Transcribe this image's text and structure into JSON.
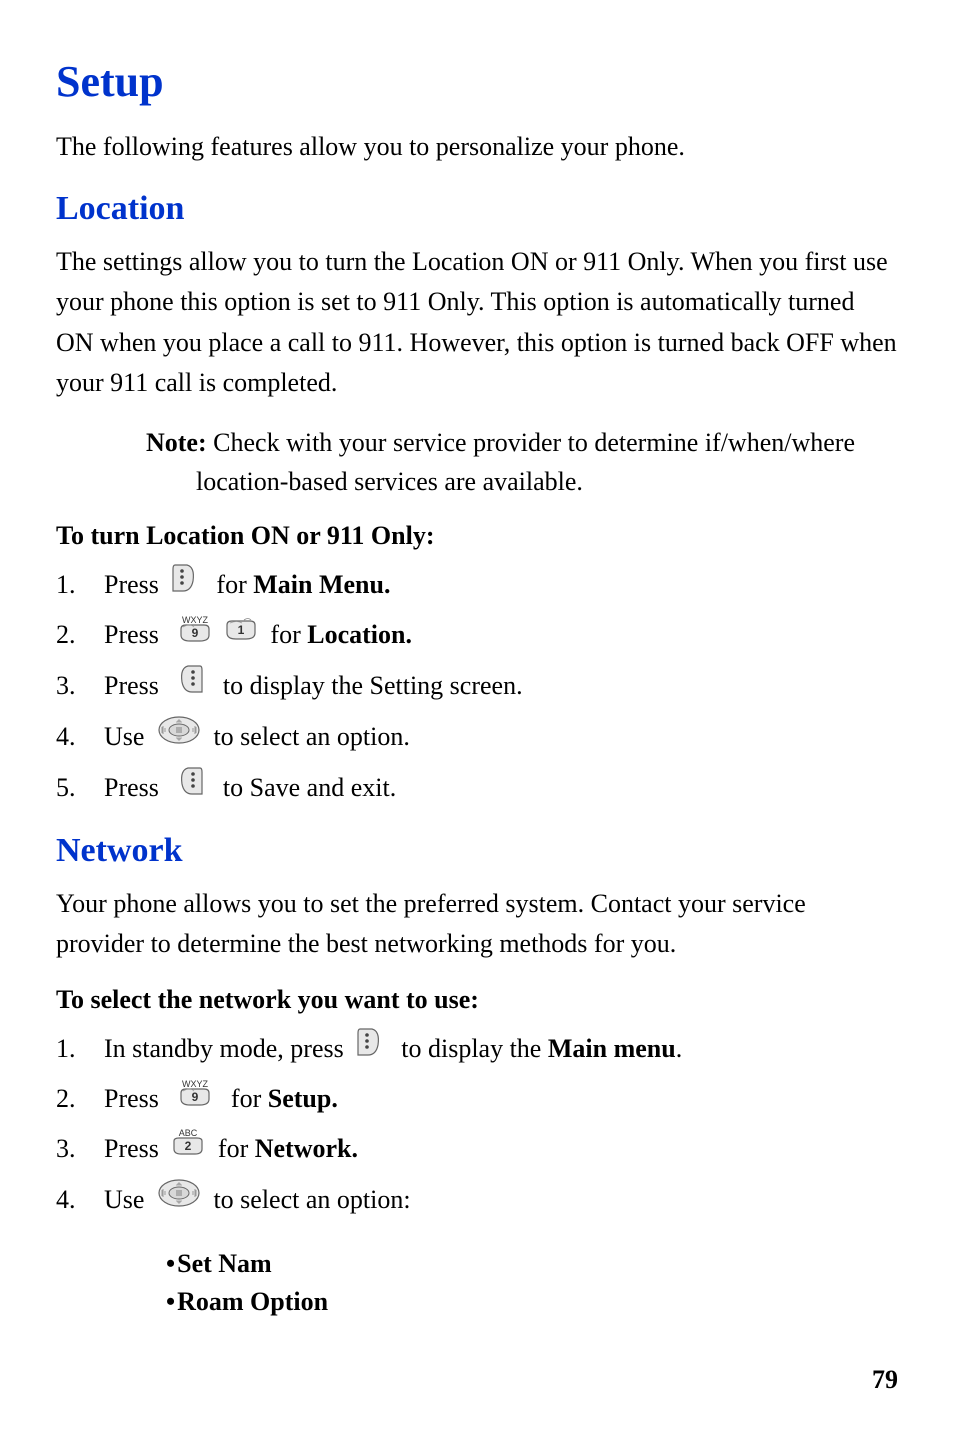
{
  "title": "Setup",
  "intro": "The following features allow you to personalize your phone.",
  "sections": {
    "location": {
      "heading": "Location",
      "body": "The settings allow you to turn the Location ON or 911 Only. When you first use your phone this option is set to 911 Only. This option is automatically turned ON when you place a call to 911. However, this option is turned back OFF when your 911 call is completed.",
      "note_label": "Note:",
      "note_text": " Check with your service provider to determine if/when/where location-based services are available.",
      "procedure_title": "To turn Location ON or 911 Only:",
      "steps": [
        {
          "num": "1.",
          "pre": "Press ",
          "icon": "left-dots-key",
          "post_b": "Main Menu.",
          "post": "  for "
        },
        {
          "num": "2.",
          "pre": "Press  ",
          "icons": [
            "key-9-wxyz",
            "key-1"
          ],
          "post": " for ",
          "post_b": "Location."
        },
        {
          "num": "3.",
          "pre": "Press  ",
          "icon": "right-dots-key",
          "post": "  to display the Setting screen."
        },
        {
          "num": "4.",
          "pre": "Use ",
          "icon": "nav-pad",
          "post": " to select an option."
        },
        {
          "num": "5.",
          "pre": "Press  ",
          "icon": "right-dots-key",
          "post": "  to Save and exit."
        }
      ]
    },
    "network": {
      "heading": "Network",
      "body": "Your phone allows you to set the preferred system. Contact your service provider to determine the best networking methods for you.",
      "procedure_title": "To select the network you want to use:",
      "steps": [
        {
          "num": "1.",
          "pre": "In standby mode, press ",
          "icon": "left-dots-key",
          "post": "  to display the ",
          "post_b": "Main menu",
          "post2": "."
        },
        {
          "num": "2.",
          "pre": "Press  ",
          "icon": "key-9-wxyz",
          "post": "  for ",
          "post_b": "Setup."
        },
        {
          "num": "3.",
          "pre": "Press ",
          "icon": "key-2-abc",
          "post": " for ",
          "post_b": "Network."
        },
        {
          "num": "4.",
          "pre": "Use ",
          "icon": "nav-pad",
          "post": " to select an option:"
        }
      ],
      "options": [
        "Set Nam",
        "Roam Option"
      ]
    }
  },
  "page_number": "79"
}
